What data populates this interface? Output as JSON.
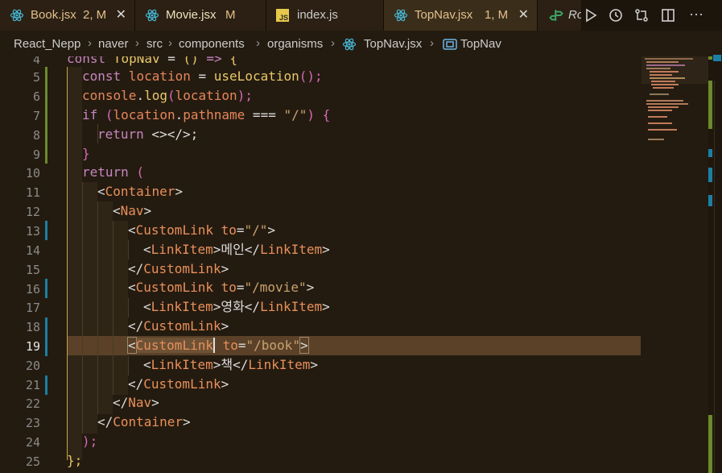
{
  "tabs": [
    {
      "name": "Book.jsx",
      "status": "2, M",
      "icon": "react-icon",
      "modified": true,
      "active": false,
      "closable": true
    },
    {
      "name": "Movie.jsx",
      "status": "M",
      "icon": "react-icon",
      "modified": true,
      "active": false,
      "closable": false
    },
    {
      "name": "index.js",
      "status": "",
      "icon": "js-file-icon",
      "modified": false,
      "active": false,
      "closable": false
    },
    {
      "name": "TopNav.jsx",
      "status": "1, M",
      "icon": "react-icon",
      "modified": true,
      "active": true,
      "closable": true
    },
    {
      "name": "Ro",
      "status": "",
      "icon": "router-icon",
      "modified": false,
      "active": false,
      "closable": false
    }
  ],
  "tab_actions": {
    "run_icon": "play-icon",
    "timeline_icon": "history-icon",
    "compare_icon": "compare-changes-icon",
    "split_icon": "split-editor-icon",
    "more_label": "···"
  },
  "breadcrumb": [
    "React_Nepp",
    "naver",
    "src",
    "components",
    "organisms",
    "TopNav.jsx",
    "TopNav"
  ],
  "editor": {
    "current_line": 19,
    "lines": [
      {
        "n": "4"
      },
      {
        "n": "5"
      },
      {
        "n": "6"
      },
      {
        "n": "7"
      },
      {
        "n": "8"
      },
      {
        "n": "9"
      },
      {
        "n": "10"
      },
      {
        "n": "11"
      },
      {
        "n": "12"
      },
      {
        "n": "13"
      },
      {
        "n": "14"
      },
      {
        "n": "15"
      },
      {
        "n": "16"
      },
      {
        "n": "17"
      },
      {
        "n": "18"
      },
      {
        "n": "19"
      },
      {
        "n": "20"
      },
      {
        "n": "21"
      },
      {
        "n": "22"
      },
      {
        "n": "23"
      },
      {
        "n": "24"
      },
      {
        "n": "25"
      }
    ],
    "code": {
      "l4_a": "const",
      "l4_b": " TopNav",
      "l4_c": " = ",
      "l4_d": "()",
      "l4_e": " => ",
      "l4_f": "{",
      "l5_a": "const",
      "l5_b": " location",
      "l5_c": " = ",
      "l5_d": "useLocation",
      "l5_e": "();",
      "l6_a": "console",
      "l6_b": ".",
      "l6_c": "log",
      "l6_d": "(",
      "l6_e": "location",
      "l6_f": ");",
      "l7_a": "if",
      "l7_b": " (",
      "l7_c": "location",
      "l7_d": ".",
      "l7_e": "pathname",
      "l7_f": " === ",
      "l7_g": "\"/\"",
      "l7_h": ") ",
      "l7_i": "{",
      "l8_a": "return",
      "l8_b": " <></>;",
      "l9_a": "}",
      "l10_a": "return",
      "l10_b": " (",
      "l11_a": "<",
      "l11_b": "Container",
      "l11_c": ">",
      "l12_a": "<",
      "l12_b": "Nav",
      "l12_c": ">",
      "l13_a": "<",
      "l13_b": "CustomLink",
      "l13_c": " to",
      "l13_d": "=",
      "l13_e": "\"/\"",
      "l13_f": ">",
      "l14_a": "<",
      "l14_b": "LinkItem",
      "l14_c": ">",
      "l14_d": "메인",
      "l14_e": "</",
      "l14_f": "LinkItem",
      "l14_g": ">",
      "l15_a": "</",
      "l15_b": "CustomLink",
      "l15_c": ">",
      "l16_a": "<",
      "l16_b": "CustomLink",
      "l16_c": " to",
      "l16_d": "=",
      "l16_e": "\"/movie\"",
      "l16_f": ">",
      "l17_a": "<",
      "l17_b": "LinkItem",
      "l17_c": ">",
      "l17_d": "영화",
      "l17_e": "</",
      "l17_f": "LinkItem",
      "l17_g": ">",
      "l18_a": "</",
      "l18_b": "CustomLink",
      "l18_c": ">",
      "l19_a": "<",
      "l19_b": "CustomLink",
      "l19_c": " to",
      "l19_d": "=",
      "l19_e": "\"/book\"",
      "l19_f": ">",
      "l20_a": "<",
      "l20_b": "LinkItem",
      "l20_c": ">",
      "l20_d": "책",
      "l20_e": "</",
      "l20_f": "LinkItem",
      "l20_g": ">",
      "l21_a": "</",
      "l21_b": "CustomLink",
      "l21_c": ">",
      "l22_a": "</",
      "l22_b": "Nav",
      "l22_c": ">",
      "l23_a": "</",
      "l23_b": "Container",
      "l23_c": ">",
      "l24_a": ");",
      "l25_a": "};"
    }
  },
  "colors": {
    "modified": "#e2c08d",
    "current_line": "#5a4128",
    "added_bar": "#6c8a2e",
    "modified_bar": "#1b7fa6"
  }
}
